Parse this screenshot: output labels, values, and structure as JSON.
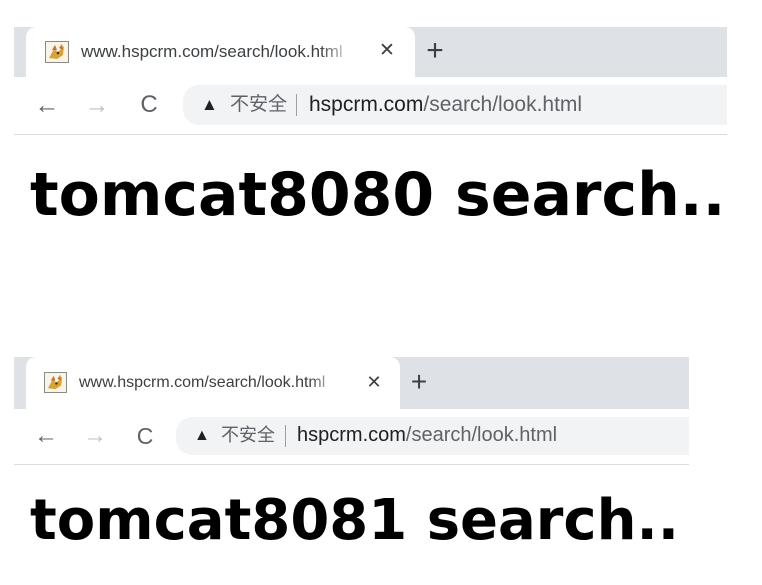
{
  "screenshots": [
    {
      "tab": {
        "favicon": "tomcat-icon",
        "title": "www.hspcrm.com/search/look.html",
        "close_glyph": "✕",
        "new_tab_glyph": "+"
      },
      "toolbar": {
        "back_glyph": "←",
        "forward_glyph": "→",
        "reload_glyph": "C",
        "security_icon": "warning-triangle-icon",
        "security_glyph": "▲",
        "security_label": "不安全",
        "url_host": "hspcrm.com",
        "url_path": "/search/look.html"
      },
      "page": {
        "heading": "tomcat8080 search.."
      }
    },
    {
      "tab": {
        "favicon": "tomcat-icon",
        "title": "www.hspcrm.com/search/look.html",
        "close_glyph": "✕",
        "new_tab_glyph": "+"
      },
      "toolbar": {
        "back_glyph": "←",
        "forward_glyph": "→",
        "reload_glyph": "C",
        "security_icon": "warning-triangle-icon",
        "security_glyph": "▲",
        "security_label": "不安全",
        "url_host": "hspcrm.com",
        "url_path": "/search/look.html"
      },
      "page": {
        "heading": "tomcat8081 search.."
      }
    }
  ],
  "colors": {
    "tab_strip": "#dee1e6",
    "omnibox": "#f1f3f4",
    "nav_active": "#5f6368",
    "nav_disabled": "#bdc1c6",
    "url_host": "#202124",
    "url_path": "#5f6368"
  }
}
